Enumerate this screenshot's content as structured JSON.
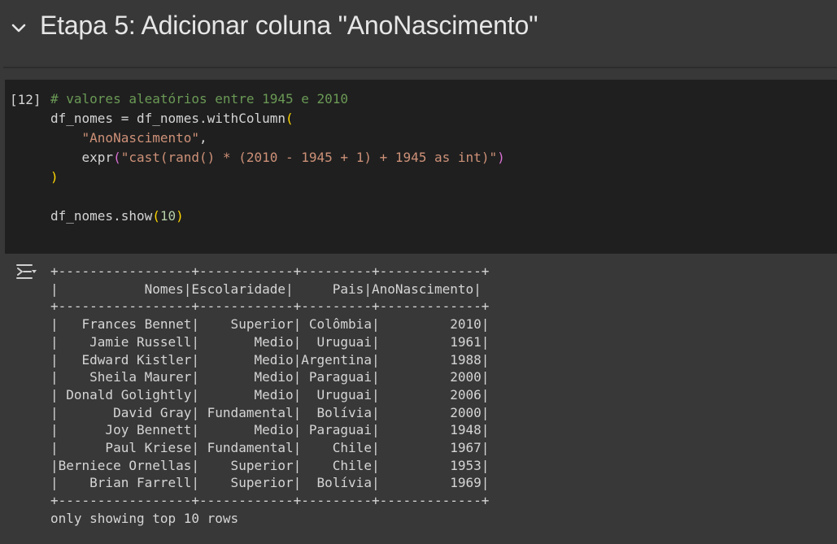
{
  "section": {
    "icon": "chevron-down-icon",
    "title": "Etapa 5: Adicionar coluna \"AnoNascimento\""
  },
  "code_cell": {
    "execution_count": "[12]",
    "comment": "# valores aleatórios entre 1945 e 2010",
    "line2_a": "df_nomes = df_nomes.withColumn",
    "line3_str": "\"AnoNascimento\"",
    "line3_tail": ",",
    "line4_fn": "expr",
    "line4_str": "\"cast(rand() * (2010 - 1945 + 1) + 1945 as int)\"",
    "line6_a": "df_nomes.show",
    "line6_num": "10"
  },
  "output": {
    "icon": "output-toggle-icon",
    "border": "+-----------------+------------+---------+-------------+",
    "header_line": "|           Nomes|Escolaridade|     Pais|AnoNascimento|",
    "columns": [
      "Nomes",
      "Escolaridade",
      "Pais",
      "AnoNascimento"
    ],
    "rows": [
      [
        "Frances Bennet",
        "Superior",
        "Colômbia",
        "2010"
      ],
      [
        "Jamie Russell",
        "Medio",
        "Uruguai",
        "1961"
      ],
      [
        "Edward Kistler",
        "Medio",
        "Argentina",
        "1988"
      ],
      [
        "Sheila Maurer",
        "Medio",
        "Paraguai",
        "2000"
      ],
      [
        "Donald Golightly",
        "Medio",
        "Uruguai",
        "2006"
      ],
      [
        "David Gray",
        "Fundamental",
        "Bolívia",
        "2000"
      ],
      [
        "Joy Bennett",
        "Medio",
        "Paraguai",
        "1948"
      ],
      [
        "Paul Kriese",
        "Fundamental",
        "Chile",
        "1967"
      ],
      [
        "Berniece Ornellas",
        "Superior",
        "Chile",
        "1953"
      ],
      [
        "Brian Farrell",
        "Superior",
        "Bolívia",
        "1969"
      ]
    ],
    "footer": "only showing top 10 rows"
  }
}
